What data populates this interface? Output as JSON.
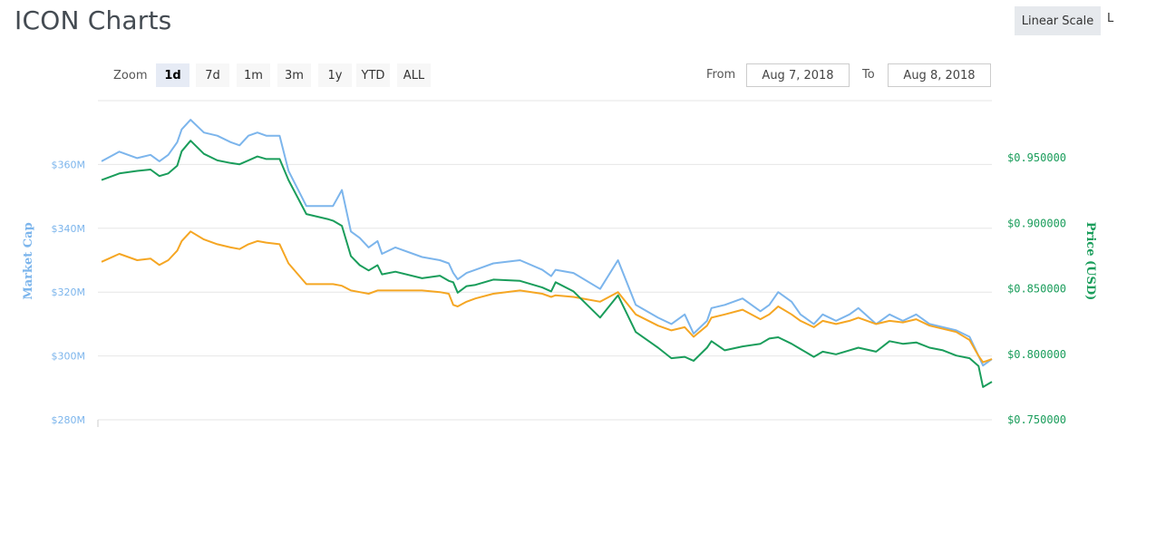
{
  "header": {
    "title": "ICON Charts",
    "scale_button": "Linear Scale",
    "scale_button_2": "L"
  },
  "zoom": {
    "label": "Zoom",
    "options": [
      "1d",
      "7d",
      "1m",
      "3m",
      "1y",
      "YTD",
      "ALL"
    ],
    "active": "1d"
  },
  "range": {
    "from_label": "From",
    "from_value": "Aug 7, 2018",
    "to_label": "To",
    "to_value": "Aug 8, 2018"
  },
  "colors": {
    "market_cap": "#7cb5ec",
    "price_usd": "#1a9d5b",
    "price_btc": "#f5a623",
    "grid": "#e6e6e6"
  },
  "chart_data": {
    "type": "line",
    "title": "ICON Charts",
    "x_range": [
      "Aug 7, 2018",
      "Aug 8, 2018"
    ],
    "y_left": {
      "label": "Market Cap",
      "ticks": [
        "$360M",
        "$340M",
        "$320M",
        "$300M",
        "$280M"
      ],
      "tick_values": [
        360,
        340,
        320,
        300,
        280
      ],
      "range": [
        280,
        380
      ]
    },
    "y_right": {
      "label": "Price (USD)",
      "ticks": [
        "$0.950000",
        "$0.900000",
        "$0.850000",
        "$0.800000",
        "$0.750000"
      ],
      "tick_values": [
        0.95,
        0.9,
        0.85,
        0.8,
        0.75
      ],
      "range": [
        0.75,
        0.9936
      ]
    },
    "grid": true,
    "legend": "none",
    "series": [
      {
        "axis": "left",
        "color": "#7cb5ec",
        "x": [
          0,
          0.02,
          0.04,
          0.055,
          0.065,
          0.075,
          0.085,
          0.09,
          0.1,
          0.115,
          0.13,
          0.145,
          0.155,
          0.165,
          0.175,
          0.185,
          0.2,
          0.21,
          0.23,
          0.255,
          0.26,
          0.27,
          0.28,
          0.29,
          0.3,
          0.31,
          0.315,
          0.33,
          0.36,
          0.38,
          0.39,
          0.395,
          0.4,
          0.41,
          0.42,
          0.44,
          0.47,
          0.495,
          0.505,
          0.51,
          0.53,
          0.56,
          0.58,
          0.6,
          0.625,
          0.64,
          0.655,
          0.665,
          0.68,
          0.685,
          0.7,
          0.72,
          0.74,
          0.75,
          0.76,
          0.775,
          0.785,
          0.8,
          0.81,
          0.825,
          0.84,
          0.85,
          0.87,
          0.885,
          0.9,
          0.915,
          0.93,
          0.945,
          0.96,
          0.975,
          0.985,
          0.99,
          1.0
        ],
        "values": [
          361,
          364,
          362,
          363,
          361,
          363,
          367,
          371,
          374,
          370,
          369,
          367,
          366,
          369,
          370,
          369,
          369,
          358,
          347,
          347,
          347,
          352,
          339,
          337,
          334,
          336,
          332,
          334,
          331,
          330,
          329,
          326,
          324,
          326,
          327,
          329,
          330,
          327,
          325,
          327,
          326,
          321,
          330,
          316,
          312,
          310,
          313,
          307,
          311,
          315,
          316,
          318,
          314,
          316,
          320,
          317,
          313,
          310,
          313,
          311,
          313,
          315,
          310,
          313,
          311,
          313,
          310,
          309,
          308,
          306,
          300,
          297,
          299
        ]
      },
      {
        "axis": "right",
        "color": "#1a9d5b",
        "x": [
          0,
          0.02,
          0.04,
          0.055,
          0.065,
          0.075,
          0.085,
          0.09,
          0.1,
          0.115,
          0.13,
          0.145,
          0.155,
          0.165,
          0.175,
          0.185,
          0.2,
          0.21,
          0.23,
          0.255,
          0.26,
          0.27,
          0.28,
          0.29,
          0.3,
          0.31,
          0.315,
          0.33,
          0.36,
          0.38,
          0.39,
          0.395,
          0.4,
          0.41,
          0.42,
          0.44,
          0.47,
          0.495,
          0.505,
          0.51,
          0.53,
          0.56,
          0.58,
          0.6,
          0.625,
          0.64,
          0.655,
          0.665,
          0.68,
          0.685,
          0.7,
          0.72,
          0.74,
          0.75,
          0.76,
          0.775,
          0.785,
          0.8,
          0.81,
          0.825,
          0.84,
          0.85,
          0.87,
          0.885,
          0.9,
          0.915,
          0.93,
          0.945,
          0.96,
          0.975,
          0.985,
          0.99,
          1.0
        ],
        "values": [
          0.933,
          0.938,
          0.94,
          0.941,
          0.936,
          0.938,
          0.944,
          0.955,
          0.963,
          0.953,
          0.948,
          0.946,
          0.945,
          0.948,
          0.951,
          0.949,
          0.949,
          0.933,
          0.907,
          0.903,
          0.902,
          0.898,
          0.875,
          0.868,
          0.864,
          0.868,
          0.861,
          0.863,
          0.858,
          0.86,
          0.856,
          0.855,
          0.847,
          0.852,
          0.853,
          0.857,
          0.856,
          0.851,
          0.848,
          0.855,
          0.848,
          0.828,
          0.845,
          0.817,
          0.805,
          0.797,
          0.798,
          0.795,
          0.805,
          0.81,
          0.803,
          0.806,
          0.808,
          0.812,
          0.813,
          0.808,
          0.804,
          0.798,
          0.802,
          0.8,
          0.803,
          0.805,
          0.802,
          0.81,
          0.808,
          0.809,
          0.805,
          0.803,
          0.799,
          0.797,
          0.791,
          0.775,
          0.779
        ]
      },
      {
        "axis": "left",
        "color": "#f5a623",
        "x": [
          0,
          0.02,
          0.04,
          0.055,
          0.065,
          0.075,
          0.085,
          0.09,
          0.1,
          0.115,
          0.13,
          0.145,
          0.155,
          0.165,
          0.175,
          0.185,
          0.2,
          0.21,
          0.23,
          0.255,
          0.26,
          0.27,
          0.28,
          0.29,
          0.3,
          0.31,
          0.315,
          0.33,
          0.36,
          0.38,
          0.39,
          0.395,
          0.4,
          0.41,
          0.42,
          0.44,
          0.47,
          0.495,
          0.505,
          0.51,
          0.53,
          0.56,
          0.58,
          0.6,
          0.625,
          0.64,
          0.655,
          0.665,
          0.68,
          0.685,
          0.7,
          0.72,
          0.74,
          0.75,
          0.76,
          0.775,
          0.785,
          0.8,
          0.81,
          0.825,
          0.84,
          0.85,
          0.87,
          0.885,
          0.9,
          0.915,
          0.93,
          0.945,
          0.96,
          0.975,
          0.985,
          0.99,
          1.0
        ],
        "values": [
          329.5,
          332,
          330,
          330.5,
          328.5,
          330,
          333,
          336,
          339,
          336.5,
          335,
          334,
          333.5,
          335,
          336,
          335.5,
          335,
          329,
          322.5,
          322.5,
          322.5,
          322,
          320.5,
          320,
          319.5,
          320.5,
          320.5,
          320.5,
          320.5,
          320,
          319.5,
          316,
          315.5,
          317,
          318,
          319.5,
          320.5,
          319.5,
          318.5,
          319,
          318.5,
          317,
          320,
          313,
          309.5,
          308,
          309,
          306,
          309.5,
          312,
          313,
          314.5,
          311.5,
          313,
          315.5,
          313,
          311,
          309,
          311,
          310,
          311,
          312,
          310,
          311,
          310.5,
          311.5,
          309.5,
          308.5,
          307.5,
          305,
          300,
          298,
          299
        ]
      }
    ]
  }
}
